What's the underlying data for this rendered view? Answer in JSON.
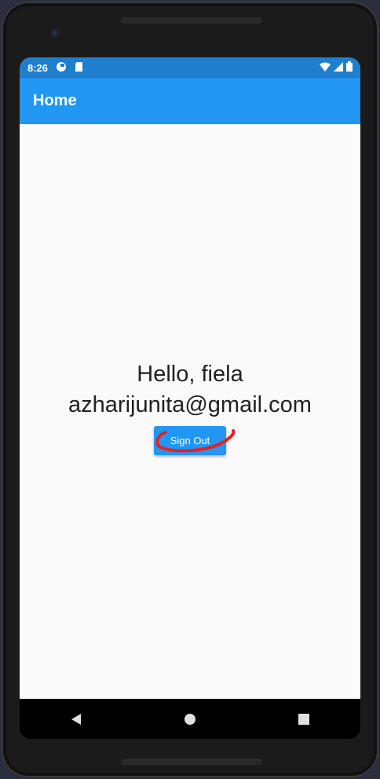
{
  "status_bar": {
    "time": "8:26"
  },
  "app_bar": {
    "title": "Home"
  },
  "content": {
    "greeting": "Hello, fiela",
    "email": "azharijunita@gmail.com",
    "sign_out_label": "Sign Out"
  },
  "colors": {
    "primary": "#2196f3",
    "annotation": "#e81f26"
  }
}
